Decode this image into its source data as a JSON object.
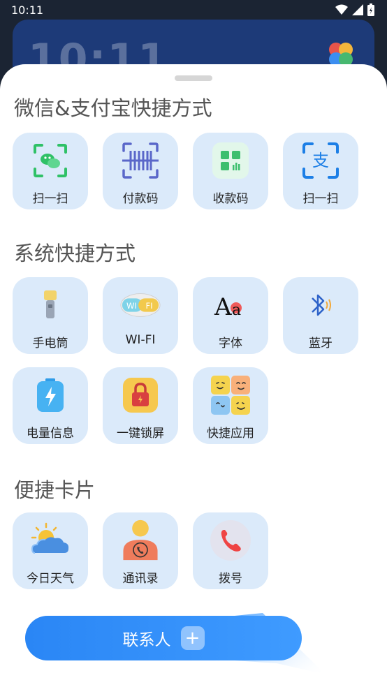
{
  "status_bar": {
    "time": "10:11"
  },
  "background_widget": {
    "clock": "10:11"
  },
  "sections": [
    {
      "title": "微信&支付宝快捷方式",
      "items": [
        {
          "label": "扫一扫",
          "icon": "wechat-scan-icon"
        },
        {
          "label": "付款码",
          "icon": "payment-code-icon"
        },
        {
          "label": "收款码",
          "icon": "receive-code-icon"
        },
        {
          "label": "扫一扫",
          "icon": "alipay-scan-icon"
        }
      ]
    },
    {
      "title": "系统快捷方式",
      "items": [
        {
          "label": "手电筒",
          "icon": "flashlight-icon"
        },
        {
          "label": "WI-FI",
          "icon": "wifi-icon"
        },
        {
          "label": "字体",
          "icon": "font-icon"
        },
        {
          "label": "蓝牙",
          "icon": "bluetooth-icon"
        },
        {
          "label": "电量信息",
          "icon": "battery-icon"
        },
        {
          "label": "一键锁屏",
          "icon": "lock-screen-icon"
        },
        {
          "label": "快捷应用",
          "icon": "quick-apps-icon"
        }
      ]
    },
    {
      "title": "便捷卡片",
      "items": [
        {
          "label": "今日天气",
          "icon": "weather-icon"
        },
        {
          "label": "通讯录",
          "icon": "contacts-icon"
        },
        {
          "label": "拨号",
          "icon": "dial-icon"
        }
      ]
    }
  ],
  "contact_button": {
    "label": "联系人",
    "plus": "+"
  },
  "colors": {
    "tile_bg": "#dbeafa",
    "accent": "#2a86f5",
    "sheet_bg": "#ffffff"
  }
}
